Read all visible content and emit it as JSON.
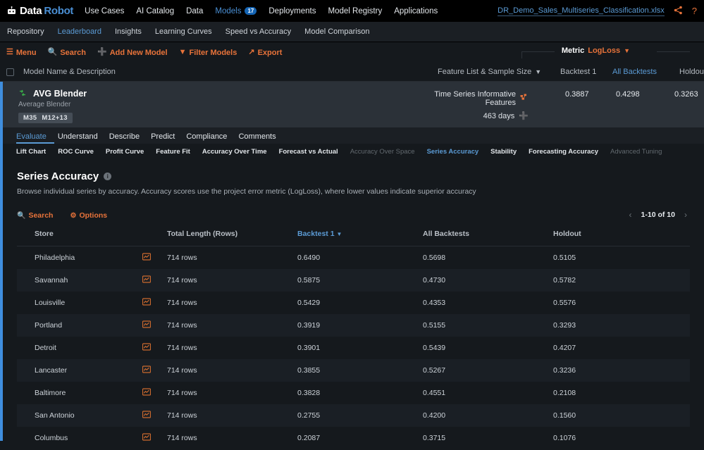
{
  "topnav": {
    "brand_first": "Data",
    "brand_second": "Robot",
    "items": [
      {
        "label": "Use Cases",
        "active": false,
        "badge": null
      },
      {
        "label": "AI Catalog",
        "active": false,
        "badge": null
      },
      {
        "label": "Data",
        "active": false,
        "badge": null
      },
      {
        "label": "Models",
        "active": true,
        "badge": "17"
      },
      {
        "label": "Deployments",
        "active": false,
        "badge": null
      },
      {
        "label": "Model Registry",
        "active": false,
        "badge": null
      },
      {
        "label": "Applications",
        "active": false,
        "badge": null
      }
    ],
    "dataset": "DR_Demo_Sales_Multiseries_Classification.xlsx",
    "share_icon": "share-icon",
    "help_icon": "help-icon"
  },
  "subnav": {
    "items": [
      {
        "label": "Repository",
        "active": false
      },
      {
        "label": "Leaderboard",
        "active": true
      },
      {
        "label": "Insights",
        "active": false
      },
      {
        "label": "Learning Curves",
        "active": false
      },
      {
        "label": "Speed vs Accuracy",
        "active": false
      },
      {
        "label": "Model Comparison",
        "active": false
      }
    ]
  },
  "toolbar": {
    "menu": "Menu",
    "search": "Search",
    "add_new_model": "Add New Model",
    "filter_models": "Filter Models",
    "export": "Export",
    "metric_label": "Metric",
    "metric_value": "LogLoss"
  },
  "leaderboard_header": {
    "model_name": "Model Name & Description",
    "feature_list": "Feature List & Sample Size",
    "backtest1": "Backtest 1",
    "all_backtests": "All Backtests",
    "holdout": "Holdout"
  },
  "model_card": {
    "title": "AVG Blender",
    "subtitle": "Average Blender",
    "tags": [
      "M35",
      "M12+13"
    ],
    "feature_list": "Time Series Informative Features",
    "sample_size": "463 days",
    "backtest1": "0.3887",
    "all_backtests": "0.4298",
    "holdout": "0.3263"
  },
  "model_tabs": [
    {
      "label": "Evaluate",
      "active": true
    },
    {
      "label": "Understand",
      "active": false
    },
    {
      "label": "Describe",
      "active": false
    },
    {
      "label": "Predict",
      "active": false
    },
    {
      "label": "Compliance",
      "active": false
    },
    {
      "label": "Comments",
      "active": false
    }
  ],
  "sub_tabs": [
    {
      "label": "Lift Chart",
      "active": false,
      "disabled": false
    },
    {
      "label": "ROC Curve",
      "active": false,
      "disabled": false
    },
    {
      "label": "Profit Curve",
      "active": false,
      "disabled": false
    },
    {
      "label": "Feature Fit",
      "active": false,
      "disabled": false
    },
    {
      "label": "Accuracy Over Time",
      "active": false,
      "disabled": false
    },
    {
      "label": "Forecast vs Actual",
      "active": false,
      "disabled": false
    },
    {
      "label": "Accuracy Over Space",
      "active": false,
      "disabled": true
    },
    {
      "label": "Series Accuracy",
      "active": true,
      "disabled": false
    },
    {
      "label": "Stability",
      "active": false,
      "disabled": false
    },
    {
      "label": "Forecasting Accuracy",
      "active": false,
      "disabled": false
    },
    {
      "label": "Advanced Tuning",
      "active": false,
      "disabled": true
    }
  ],
  "series_accuracy": {
    "title": "Series Accuracy",
    "info_glyph": "i",
    "description": "Browse individual series by accuracy. Accuracy scores use the project error metric (LogLoss), where lower values indicate superior accuracy",
    "search": "Search",
    "options": "Options",
    "pager": {
      "prev": "‹",
      "label": "1-10 of 10",
      "next": "›"
    },
    "columns": [
      "Store",
      "",
      "Total Length (Rows)",
      "Backtest 1",
      "All Backtests",
      "Holdout"
    ],
    "sorted_column": "Backtest 1",
    "sort_direction": "desc",
    "rows": [
      {
        "store": "Philadelphia",
        "chart_icon": "series-chart-icon",
        "length": "714 rows",
        "backtest1": "0.6490",
        "all_backtests": "0.5698",
        "holdout": "0.5105"
      },
      {
        "store": "Savannah",
        "chart_icon": "series-chart-icon",
        "length": "714 rows",
        "backtest1": "0.5875",
        "all_backtests": "0.4730",
        "holdout": "0.5782"
      },
      {
        "store": "Louisville",
        "chart_icon": "series-chart-icon",
        "length": "714 rows",
        "backtest1": "0.5429",
        "all_backtests": "0.4353",
        "holdout": "0.5576"
      },
      {
        "store": "Portland",
        "chart_icon": "series-chart-icon",
        "length": "714 rows",
        "backtest1": "0.3919",
        "all_backtests": "0.5155",
        "holdout": "0.3293"
      },
      {
        "store": "Detroit",
        "chart_icon": "series-chart-icon",
        "length": "714 rows",
        "backtest1": "0.3901",
        "all_backtests": "0.5439",
        "holdout": "0.4207"
      },
      {
        "store": "Lancaster",
        "chart_icon": "series-chart-icon",
        "length": "714 rows",
        "backtest1": "0.3855",
        "all_backtests": "0.5267",
        "holdout": "0.3236"
      },
      {
        "store": "Baltimore",
        "chart_icon": "series-chart-icon",
        "length": "714 rows",
        "backtest1": "0.3828",
        "all_backtests": "0.4551",
        "holdout": "0.2108"
      },
      {
        "store": "San Antonio",
        "chart_icon": "series-chart-icon",
        "length": "714 rows",
        "backtest1": "0.2755",
        "all_backtests": "0.4200",
        "holdout": "0.1560"
      },
      {
        "store": "Columbus",
        "chart_icon": "series-chart-icon",
        "length": "714 rows",
        "backtest1": "0.2087",
        "all_backtests": "0.3715",
        "holdout": "0.1076"
      }
    ]
  },
  "colors": {
    "accent_orange": "#e8733a",
    "accent_blue": "#5b9bd5",
    "card_bg": "#2b3138",
    "page_bg": "#15191d",
    "left_rail": "#3f8ede",
    "blender_green": "#3ab54a"
  }
}
